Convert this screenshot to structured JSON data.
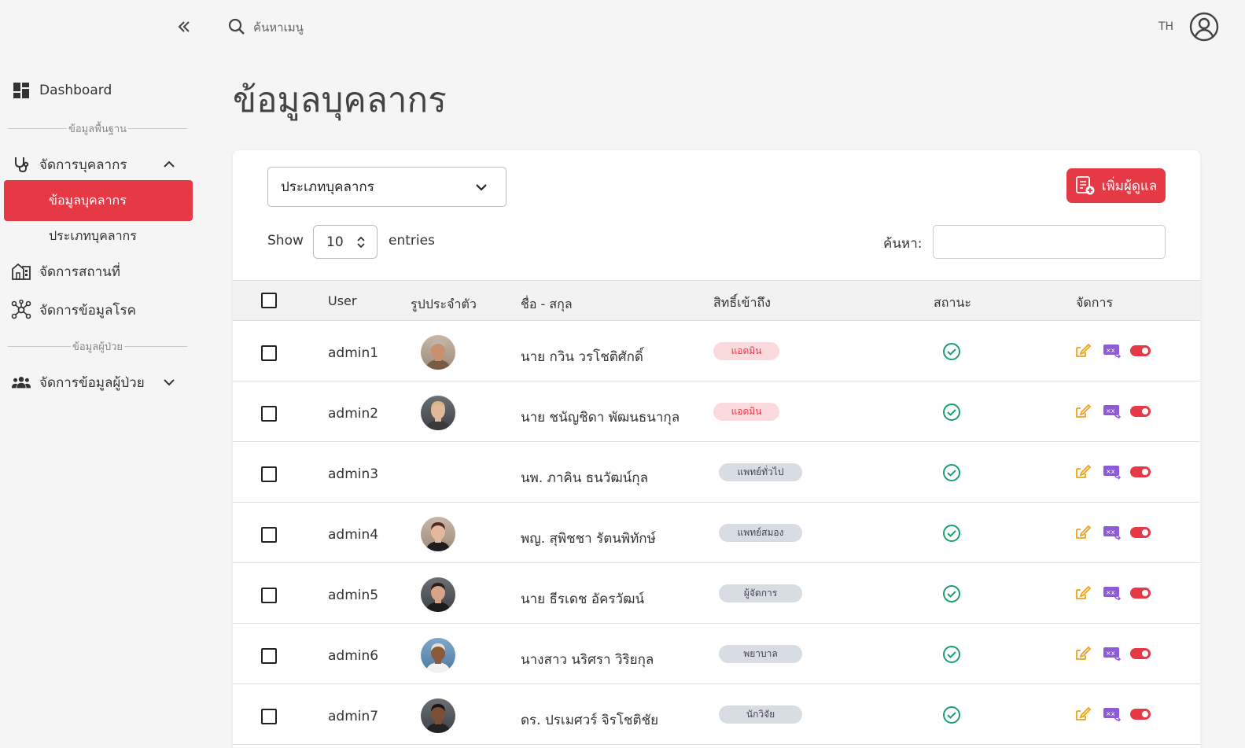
{
  "topbar": {
    "search_placeholder": "ค้นหาเมนู",
    "lang": "TH"
  },
  "sidebar": {
    "dashboard": "Dashboard",
    "section_basic": "ข้อมูลพื้นฐาน",
    "personnel": "จัดการบุคลากร",
    "personnel_info": "ข้อมูลบุคลากร",
    "personnel_type": "ประเภทบุคลากร",
    "places": "จัดการสถานที่",
    "diseases": "จัดการข้อมูลโรค",
    "section_patient": "ข้อมูลผู้ป่วย",
    "patients": "จัดการข้อมูลผู้ป่วย"
  },
  "page": {
    "title": "ข้อมูลบุคลากร"
  },
  "controls": {
    "type_select": "ประเภทบุคลากร",
    "add_button": "เพิ่มผู้ดูแล",
    "show": "Show",
    "entries_value": "10",
    "entries": "entries",
    "search_label": "ค้นหา:"
  },
  "table": {
    "headers": {
      "user": "User",
      "photo": "รูปประจำตัว",
      "name": "ชื่อ - สกุล",
      "access": "สิทธิ์เข้าถึง",
      "status": "สถานะ",
      "manage": "จัดการ"
    },
    "rows": [
      {
        "user": "admin1",
        "name": "นาย กวิน วรโชติศักดิ์",
        "role": "แอดมิน"
      },
      {
        "user": "admin2",
        "name": "นาย ชนัญชิดา พัฒนธนากุล",
        "role": "แอดมิน"
      },
      {
        "user": "admin3",
        "name": "นพ. ภาคิน ธนวัฒน์กุล",
        "role": "แพทย์ทั่วไป"
      },
      {
        "user": "admin4",
        "name": "พญ. สุพิชชา รัตนพิทักษ์",
        "role": "แพทย์สมอง"
      },
      {
        "user": "admin5",
        "name": "นาย ธีรเดช อัครวัฒน์",
        "role": "ผู้จัดการ"
      },
      {
        "user": "admin6",
        "name": "นางสาว นริศรา วิริยกุล",
        "role": "พยาบาล"
      },
      {
        "user": "admin7",
        "name": "ดร. ปรเมศวร์ จิรโชติชัย",
        "role": "นักวิจัย"
      }
    ]
  },
  "colors": {
    "accent": "#e63946",
    "status_ok": "#1aa06d",
    "edit": "#f0a11b",
    "translate": "#8e5bd6"
  }
}
